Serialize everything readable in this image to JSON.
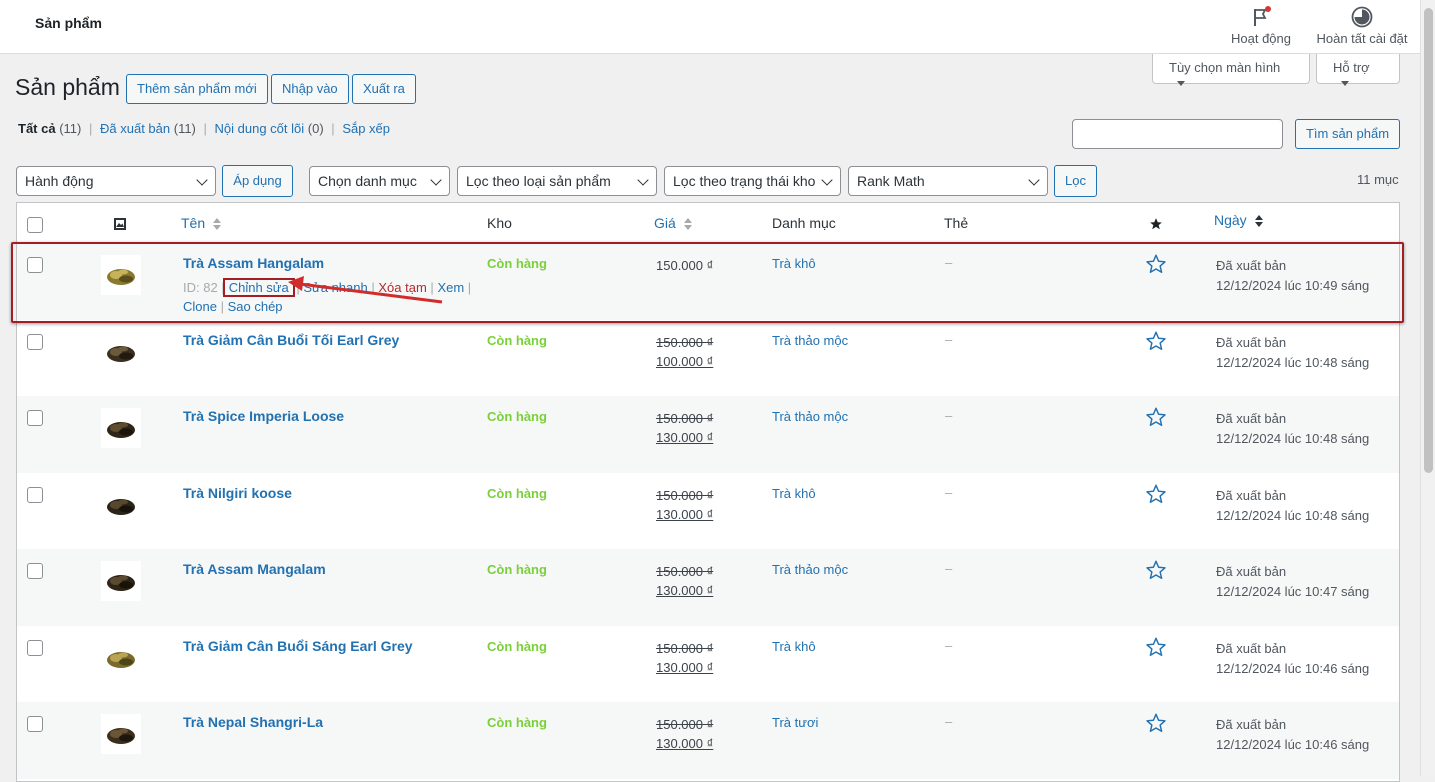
{
  "header": {
    "brand": "Sản phẩm",
    "activity_label": "Hoạt động",
    "setup_label": "Hoàn tất cài đặt"
  },
  "screen_meta": {
    "screen_options": "Tùy chọn màn hình",
    "help": "Hỗ trợ"
  },
  "page": {
    "title": "Sản phẩm",
    "add_new": "Thêm sản phẩm mới",
    "import": "Nhập vào",
    "export": "Xuất ra"
  },
  "views": {
    "all": "Tất cả",
    "all_count": "(11)",
    "published": "Đã xuất bản",
    "published_count": "(11)",
    "cornerstone": "Nội dung cốt lõi",
    "cornerstone_count": "(0)",
    "sort": "Sắp xếp",
    "separator": "|"
  },
  "search": {
    "value": "",
    "button": "Tìm sản phẩm"
  },
  "filters": {
    "bulk_action": "Hành động",
    "apply": "Áp dụng",
    "category": "Chọn danh mục",
    "product_type": "Lọc theo loại sản phẩm",
    "stock_status": "Lọc theo trạng thái kho",
    "rank_math": "Rank Math",
    "filter_button": "Lọc",
    "item_count": "11 mục"
  },
  "columns": {
    "name": "Tên",
    "stock": "Kho",
    "price": "Giá",
    "categories": "Danh mục",
    "tags": "Thẻ",
    "date": "Ngày"
  },
  "row_actions": {
    "id_label": "ID: 82",
    "edit": "Chỉnh sửa",
    "quick_edit": "Sửa nhanh",
    "trash": "Xóa tạm",
    "view": "Xem",
    "clone": "Clone",
    "duplicate": "Sao chép",
    "separator": "|"
  },
  "rows": [
    {
      "name": "Trà Assam Hangalam",
      "stock": "Còn hàng",
      "price_old": "",
      "price": "150.000 ₫",
      "category": "Trà khô",
      "tags": "–",
      "status": "Đã xuất bản",
      "date": "12/12/2024 lúc 10:49 sáng"
    },
    {
      "name": "Trà Giảm Cân Buổi Tối Earl Grey",
      "stock": "Còn hàng",
      "price_old": "150.000 ₫",
      "price": "100.000 ₫",
      "category": "Trà thảo mộc",
      "tags": "–",
      "status": "Đã xuất bản",
      "date": "12/12/2024 lúc 10:48 sáng"
    },
    {
      "name": "Trà Spice Imperia Loose",
      "stock": "Còn hàng",
      "price_old": "150.000 ₫",
      "price": "130.000 ₫",
      "category": "Trà thảo mộc",
      "tags": "–",
      "status": "Đã xuất bản",
      "date": "12/12/2024 lúc 10:48 sáng"
    },
    {
      "name": "Trà Nilgiri koose",
      "stock": "Còn hàng",
      "price_old": "150.000 ₫",
      "price": "130.000 ₫",
      "category": "Trà khô",
      "tags": "–",
      "status": "Đã xuất bản",
      "date": "12/12/2024 lúc 10:48 sáng"
    },
    {
      "name": "Trà Assam Mangalam",
      "stock": "Còn hàng",
      "price_old": "150.000 ₫",
      "price": "130.000 ₫",
      "category": "Trà thảo mộc",
      "tags": "–",
      "status": "Đã xuất bản",
      "date": "12/12/2024 lúc 10:47 sáng"
    },
    {
      "name": "Trà Giảm Cân Buổi Sáng Earl Grey",
      "stock": "Còn hàng",
      "price_old": "150.000 ₫",
      "price": "130.000 ₫",
      "category": "Trà khô",
      "tags": "–",
      "status": "Đã xuất bản",
      "date": "12/12/2024 lúc 10:46 sáng"
    },
    {
      "name": "Trà Nepal Shangri-La",
      "stock": "Còn hàng",
      "price_old": "150.000 ₫",
      "price": "130.000 ₫",
      "category": "Trà tươi",
      "tags": "–",
      "status": "Đã xuất bản",
      "date": "12/12/2024 lúc 10:46 sáng"
    }
  ],
  "colors": {
    "link": "#2271b1",
    "in_stock": "#7ad03a",
    "trash": "#b32d2e",
    "annotation": "#a31e22"
  },
  "icons": {
    "activity": "flag-icon",
    "setup": "progress-circle-icon",
    "thumbnail_column": "image-icon",
    "featured_column": "star-filled-icon",
    "featured_row": "star-outline-icon"
  }
}
